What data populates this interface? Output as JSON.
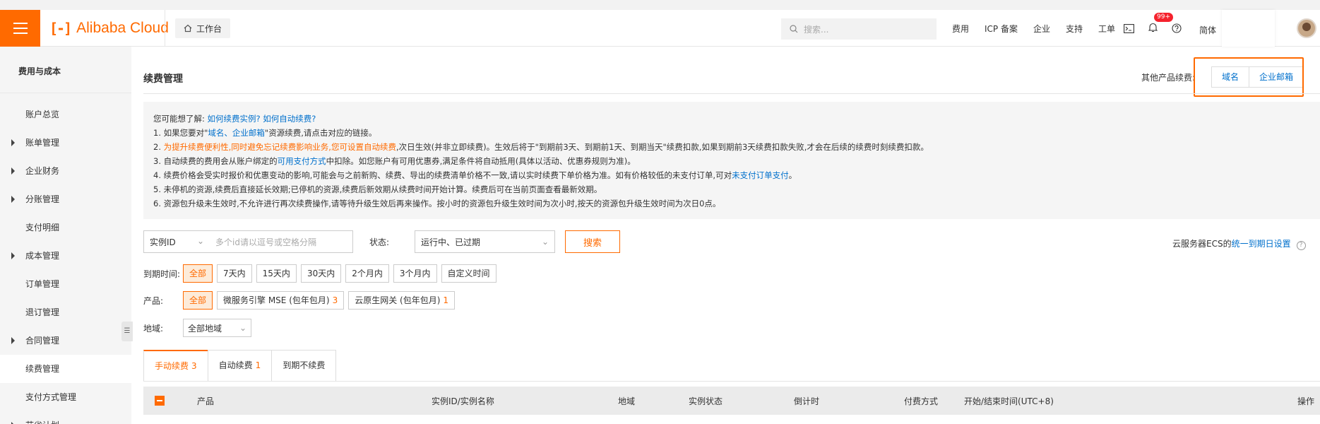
{
  "topbar": {
    "logo_mark": "[-]",
    "brand": "Alibaba Cloud",
    "workbench": "工作台",
    "search_placeholder": "搜索...",
    "links": [
      "费用",
      "ICP 备案",
      "企业",
      "支持",
      "工单"
    ],
    "notif_count": "99+",
    "lang": "简体"
  },
  "sidebar": {
    "title": "费用与成本",
    "items": [
      {
        "label": "账户总览",
        "arrow": false
      },
      {
        "label": "账单管理",
        "arrow": true
      },
      {
        "label": "企业财务",
        "arrow": true
      },
      {
        "label": "分账管理",
        "arrow": true
      },
      {
        "label": "支付明细",
        "arrow": false
      },
      {
        "label": "成本管理",
        "arrow": true
      },
      {
        "label": "订单管理",
        "arrow": false
      },
      {
        "label": "退订管理",
        "arrow": false
      },
      {
        "label": "合同管理",
        "arrow": true
      },
      {
        "label": "续费管理",
        "arrow": false,
        "active": true
      },
      {
        "label": "支付方式管理",
        "arrow": false
      },
      {
        "label": "节省计划",
        "arrow": true
      }
    ]
  },
  "page": {
    "title": "续费管理",
    "other_products_label": "其他产品续费:",
    "other_products": [
      "域名",
      "企业邮箱"
    ]
  },
  "notice": {
    "intro": "您可能想了解:",
    "intro_links": [
      "如何续费实例?",
      "如何自动续费?"
    ],
    "line1_a": "1. 如果您要对\"",
    "line1_links": "域名、企业邮箱",
    "line1_b": "\"资源续费,请点击对应的链接。",
    "line2_prefix": "2. ",
    "line2_orange": "为提升续费便利性,同时避免忘记续费影响业务,您可设置自动续费",
    "line2_rest": ",次日生效(并非立即续费)。生效后将于\"到期前3天、到期前1天、到期当天\"续费扣款,如果到期前3天续费扣款失败,才会在后续的续费时刻续费扣款。",
    "line3_a": "3. 自动续费的费用会从账户绑定的",
    "line3_link": "可用支付方式",
    "line3_b": "中扣除。如您账户有可用优惠券,满足条件将自动抵用(具体以活动、优惠券规则为准)。",
    "line4_a": "4. 续费价格会受实时报价和优惠变动的影响,可能会与之前新购、续费、导出的续费清单价格不一致,请以实时续费下单价格为准。如有价格较低的未支付订单,可对",
    "line4_link": "未支付订单支付",
    "line4_b": "。",
    "line5": "5. 未停机的资源,续费后直接延长效期;已停机的资源,续费后新效期从续费时间开始计算。续费后可在当前页面查看最新效期。",
    "line6": "6. 资源包升级未生效时,不允许进行再次续费操作,请等待升级生效后再来操作。按小时的资源包升级生效时间为次小时,按天的资源包升级生效时间为次日0点。"
  },
  "filter": {
    "id_select": "实例ID",
    "id_placeholder": "多个id请以逗号或空格分隔",
    "status_label": "状态:",
    "status_value": "运行中、已过期",
    "search_button": "搜索",
    "ecs_text": "云服务器ECS的",
    "ecs_link": "统一到期日设置",
    "expire_label": "到期时间:",
    "expire_options": [
      "全部",
      "7天内",
      "15天内",
      "30天内",
      "2个月内",
      "3个月内",
      "自定义时间"
    ],
    "product_label": "产品:",
    "product_all": "全部",
    "products": [
      {
        "name": "微服务引擎 MSE (包年包月)",
        "count": "3"
      },
      {
        "name": "云原生网关 (包年包月)",
        "count": "1"
      }
    ],
    "region_label": "地域:",
    "region_value": "全部地域"
  },
  "tabs": [
    {
      "label": "手动续费",
      "count": "3",
      "active": true
    },
    {
      "label": "自动续费",
      "count": "1",
      "active": false
    },
    {
      "label": "到期不续费",
      "count": "",
      "active": false
    }
  ],
  "table": {
    "headers": [
      "产品",
      "实例ID/实例名称",
      "地域",
      "实例状态",
      "倒计时",
      "付费方式",
      "开始/结束时间(UTC+8)",
      "操作"
    ]
  },
  "colors": {
    "accent": "#ff6a00",
    "link": "#0070cc"
  }
}
